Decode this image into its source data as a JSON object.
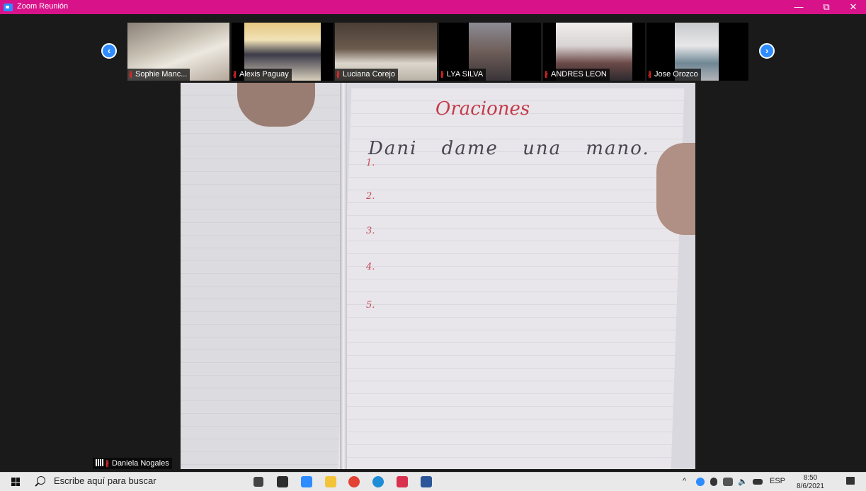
{
  "window": {
    "title": "Zoom Reunión",
    "minimize": "—",
    "restore": "⧉",
    "close": "✕"
  },
  "gallery": {
    "prev": "‹",
    "next": "›",
    "participants": [
      {
        "name": "Sophie Manc..."
      },
      {
        "name": "Alexis Paguay"
      },
      {
        "name": "Luciana Corejo"
      },
      {
        "name": "LYA SILVA"
      },
      {
        "name": "ANDRES LEON"
      },
      {
        "name": "Jose Orozco"
      }
    ]
  },
  "main": {
    "speaker": "Daniela Nogales",
    "notebook_title": "Oraciones",
    "sentence_1": "Dani dame una mano.",
    "numbers": [
      "1.",
      "2.",
      "3.",
      "4.",
      "5."
    ]
  },
  "taskbar": {
    "search_placeholder": "Escribe aquí para buscar",
    "language": "ESP",
    "time": "8:50",
    "date": "8/6/2021"
  },
  "colors": {
    "zoom_title": "#d8138a",
    "zoom_blue": "#2d8cff",
    "muted_red": "#e02828"
  }
}
